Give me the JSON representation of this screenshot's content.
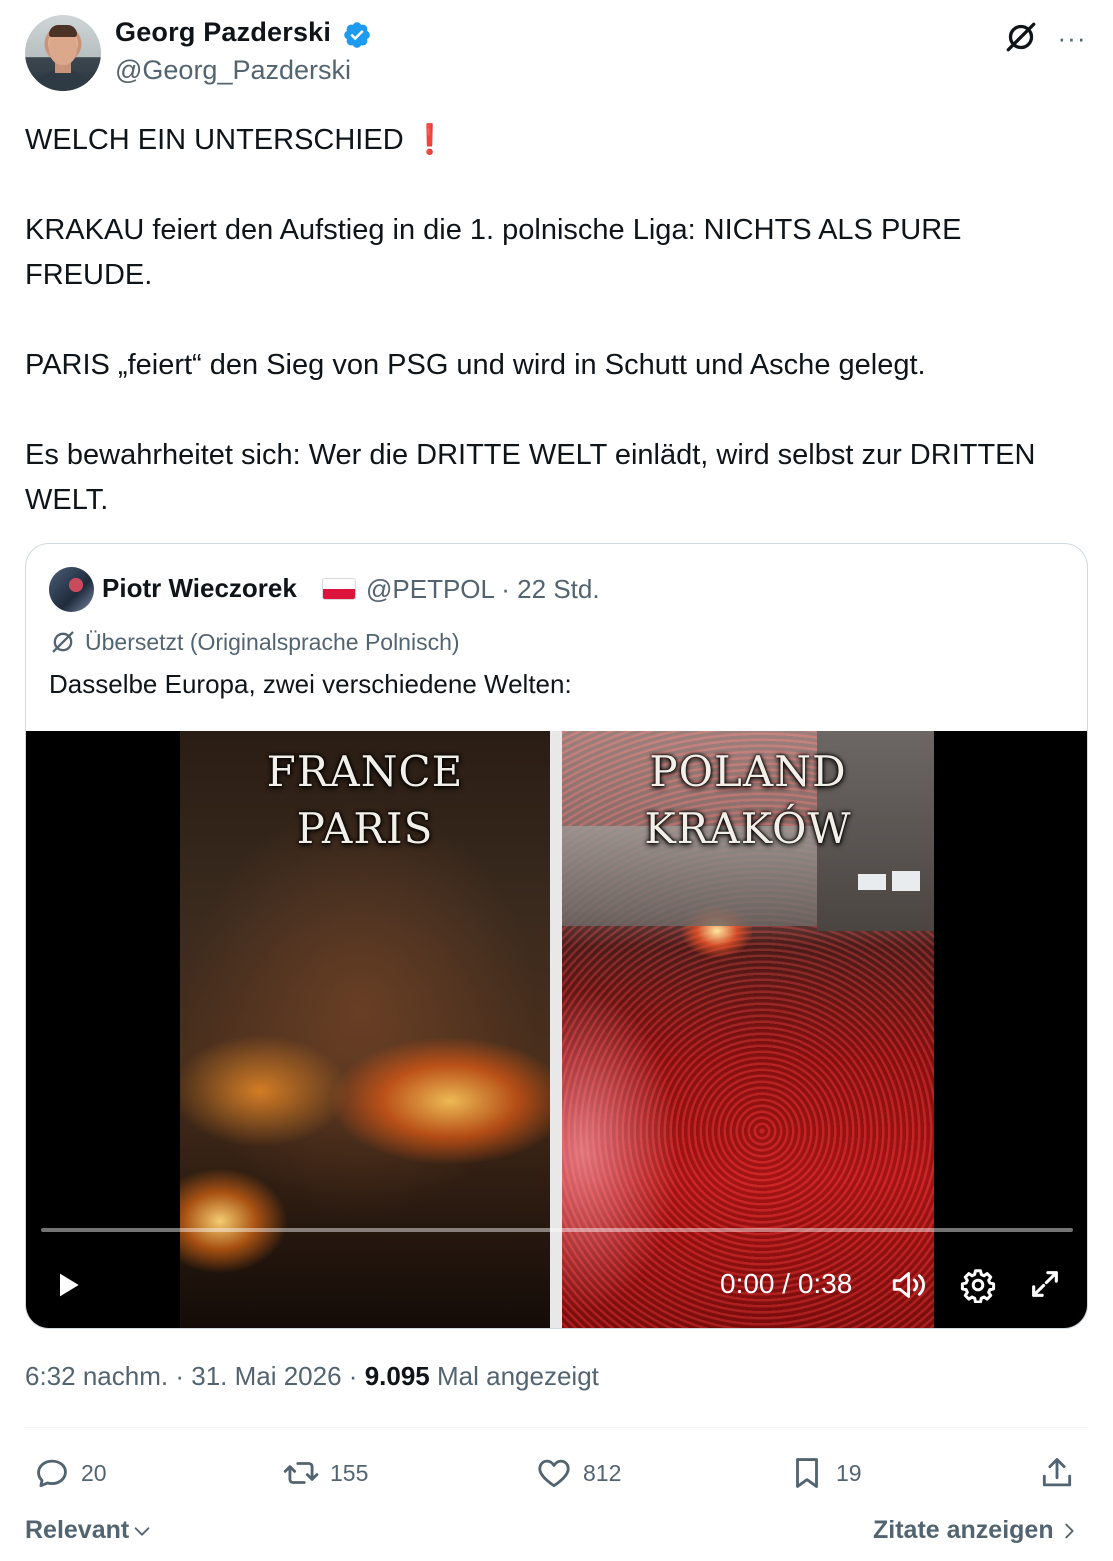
{
  "author": {
    "display_name": "Georg Pazderski",
    "handle": "@Georg_Pazderski",
    "verified": true,
    "verified_color": "#1d9bf0"
  },
  "header_actions": {
    "grok_icon": "grok-slash-icon",
    "more_icon": "more-icon",
    "more_label": "···"
  },
  "tweet": {
    "line1": "WELCH EIN UNTERSCHIED",
    "line1_emoji": "❗",
    "para2": "KRAKAU feiert den Aufstieg in die 1. polnische Liga: NICHTS ALS PURE FREUDE.",
    "para3": "PARIS „feiert“ den Sieg von PSG und wird in Schutt und Asche gelegt.",
    "para4": "Es bewahrheitet sich: Wer die DRITTE WELT einlädt, wird selbst zur DRITTEN WELT."
  },
  "quoted": {
    "display_name": "Piotr Wieczorek",
    "flag": "🇵🇱",
    "handle": "@PETPOL",
    "separator": "·",
    "age": "22 Std.",
    "translated_note": "Übersetzt (Originalsprache Polnisch)",
    "text": "Dasselbe Europa, zwei verschiedene Welten:",
    "video": {
      "left_title_1": "FRANCE",
      "left_title_2": "PARIS",
      "right_title_1": "POLAND",
      "right_title_2": "KRAKÓW",
      "time_display": "0:00 / 0:38",
      "progress": 0.0,
      "play_icon": "play-icon",
      "volume_icon": "volume-icon",
      "settings_icon": "gear-icon",
      "fullscreen_icon": "fullscreen-icon"
    }
  },
  "meta": {
    "time": "6:32 nachm.",
    "date": "31. Mai 2026",
    "views": "9.095",
    "views_label": "Mal angezeigt",
    "dot": "·"
  },
  "actions": {
    "replies": "20",
    "reposts": "155",
    "likes": "812",
    "bookmarks": "19"
  },
  "footer": {
    "sort_label": "Relevant",
    "quotes_link": "Zitate anzeigen"
  },
  "colors": {
    "text_primary": "#0f1419",
    "text_secondary": "#536471",
    "border": "#cfd9de",
    "accent": "#1d9bf0"
  }
}
